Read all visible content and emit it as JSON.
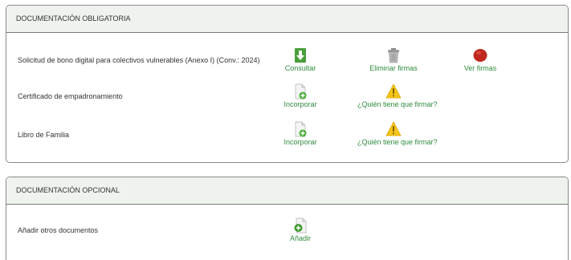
{
  "obligatoria": {
    "title": "DOCUMENTACIÓN OBLIGATORIA",
    "rows": [
      {
        "label": "Solicitud de bono digital para colectivos vulnerables (Anexo I) (Conv.: 2024)",
        "actions": [
          {
            "label": "Consultar",
            "icon": "download-arrow-icon"
          },
          {
            "label": "Eliminar firmas",
            "icon": "trash-icon"
          },
          {
            "label": "Ver firmas",
            "icon": "seal-icon"
          }
        ]
      },
      {
        "label": "Certificado de empadronamiento",
        "actions": [
          {
            "label": "Incorporar",
            "icon": "add-document-icon"
          },
          {
            "label": "¿Quién tiene que firmar?",
            "icon": "warning-icon"
          }
        ]
      },
      {
        "label": "Libro de Familia",
        "actions": [
          {
            "label": "Incorporar",
            "icon": "add-document-icon"
          },
          {
            "label": "¿Quién tiene que firmar?",
            "icon": "warning-icon"
          }
        ]
      }
    ]
  },
  "opcional": {
    "title": "DOCUMENTACIÓN OPCIONAL",
    "rows": [
      {
        "label": "Añadir otros documentos",
        "actions": [
          {
            "label": "Añadir",
            "icon": "add-document-icon"
          }
        ]
      }
    ]
  },
  "colors": {
    "link_green": "#2e8b3e",
    "header_bg": "#eef3ee",
    "border": "#8a8a8a",
    "seal_red": "#c0281e",
    "warning_yellow": "#f5c518"
  }
}
